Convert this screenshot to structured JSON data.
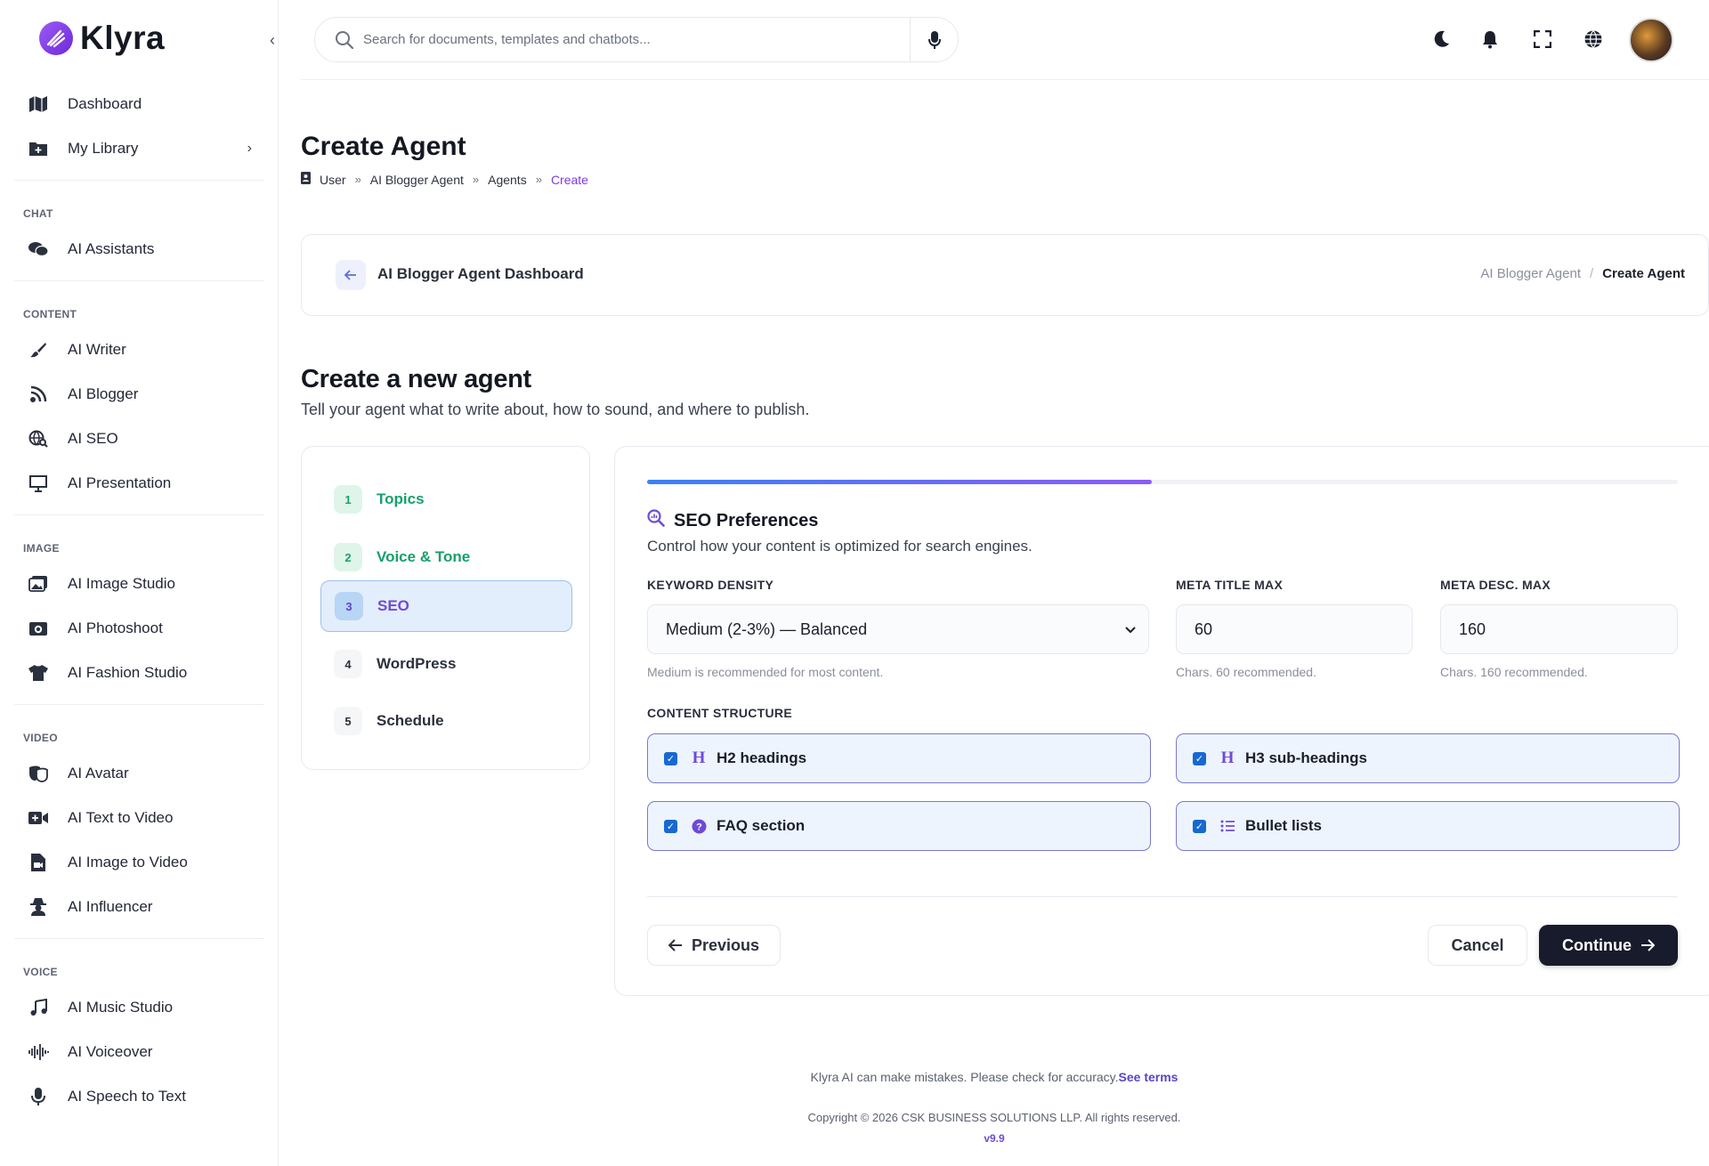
{
  "brand": {
    "name": "Klyra"
  },
  "sidebar": {
    "top_items": [
      {
        "label": "Dashboard",
        "icon": "map-icon"
      },
      {
        "label": "My Library",
        "icon": "folder-plus-icon",
        "has_chevron": true
      }
    ],
    "sections": [
      {
        "title": "CHAT",
        "items": [
          {
            "label": "AI Assistants",
            "icon": "chat-bubbles-icon"
          }
        ]
      },
      {
        "title": "CONTENT",
        "items": [
          {
            "label": "AI Writer",
            "icon": "brush-icon"
          },
          {
            "label": "AI Blogger",
            "icon": "rss-icon"
          },
          {
            "label": "AI SEO",
            "icon": "globe-search-icon"
          },
          {
            "label": "AI Presentation",
            "icon": "presentation-icon"
          }
        ]
      },
      {
        "title": "IMAGE",
        "items": [
          {
            "label": "AI Image Studio",
            "icon": "images-icon"
          },
          {
            "label": "AI Photoshoot",
            "icon": "camera-icon"
          },
          {
            "label": "AI Fashion Studio",
            "icon": "shirt-icon"
          }
        ]
      },
      {
        "title": "VIDEO",
        "items": [
          {
            "label": "AI Avatar",
            "icon": "masks-icon"
          },
          {
            "label": "AI Text to Video",
            "icon": "video-plus-icon"
          },
          {
            "label": "AI Image to Video",
            "icon": "file-video-icon"
          },
          {
            "label": "AI Influencer",
            "icon": "user-secret-icon"
          }
        ]
      },
      {
        "title": "VOICE",
        "items": [
          {
            "label": "AI Music Studio",
            "icon": "music-icon"
          },
          {
            "label": "AI Voiceover",
            "icon": "waveform-icon"
          },
          {
            "label": "AI Speech to Text",
            "icon": "microphone-icon"
          }
        ]
      }
    ]
  },
  "search": {
    "placeholder": "Search for documents, templates and chatbots..."
  },
  "page": {
    "title": "Create Agent",
    "breadcrumb": [
      "User",
      "AI Blogger Agent",
      "Agents",
      "Create"
    ]
  },
  "dashboard_card": {
    "title": "AI Blogger Agent Dashboard",
    "crumb_parent": "AI Blogger Agent",
    "crumb_current": "Create Agent"
  },
  "section": {
    "title": "Create a new agent",
    "subtitle": "Tell your agent what to write about, how to sound, and where to publish."
  },
  "steps": [
    {
      "num": "1",
      "label": "Topics",
      "state": "done"
    },
    {
      "num": "2",
      "label": "Voice & Tone",
      "state": "done"
    },
    {
      "num": "3",
      "label": "SEO",
      "state": "active"
    },
    {
      "num": "4",
      "label": "WordPress",
      "state": "todo"
    },
    {
      "num": "5",
      "label": "Schedule",
      "state": "todo"
    }
  ],
  "form": {
    "progress": 0.49,
    "title": "SEO Preferences",
    "subtitle": "Control how your content is optimized for search engines.",
    "keyword_density": {
      "label": "KEYWORD DENSITY",
      "value": "Medium (2-3%) — Balanced",
      "hint": "Medium is recommended for most content."
    },
    "meta_title_max": {
      "label": "META TITLE MAX",
      "value": "60",
      "hint": "Chars. 60 recommended."
    },
    "meta_desc_max": {
      "label": "META DESC. MAX",
      "value": "160",
      "hint": "Chars. 160 recommended."
    },
    "content_structure": {
      "label": "CONTENT STRUCTURE",
      "options": [
        {
          "label": "H2 headings",
          "checked": true,
          "icon": "heading-icon"
        },
        {
          "label": "H3 sub-headings",
          "checked": true,
          "icon": "heading-icon"
        },
        {
          "label": "FAQ section",
          "checked": true,
          "icon": "question-circle-icon"
        },
        {
          "label": "Bullet lists",
          "checked": true,
          "icon": "list-icon"
        }
      ]
    },
    "buttons": {
      "previous": "Previous",
      "cancel": "Cancel",
      "continue": "Continue"
    }
  },
  "footer": {
    "disclaimer": "Klyra AI can make mistakes. Please check for accuracy.",
    "terms_link": "See terms",
    "copyright": "Copyright © 2026 CSK BUSINESS SOLUTIONS LLP. All rights reserved.",
    "version": "v9.9"
  },
  "colors": {
    "accent": "#6d4bd6",
    "success": "#17a06a",
    "dark_button": "#171b2b"
  }
}
